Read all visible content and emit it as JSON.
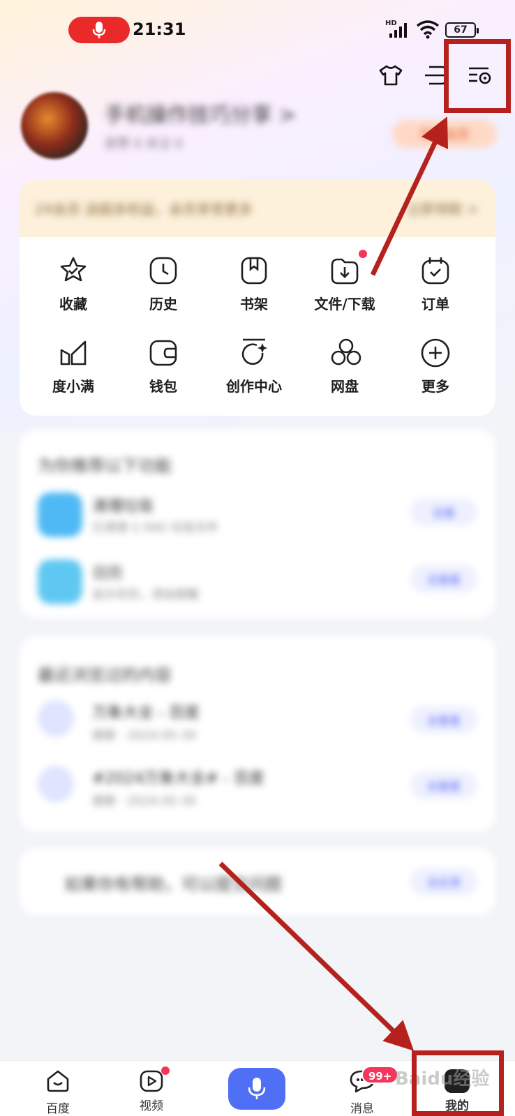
{
  "status_bar": {
    "time": "21:31",
    "battery": "67",
    "network": "HD"
  },
  "profile": {
    "name": "手机操作技巧分享 >",
    "stats": "获赞 0    关注 0",
    "vip_label": "开通会员"
  },
  "banner": {
    "text": "24会员  送超多权益，会员享受更多",
    "link": "立即领取 >"
  },
  "grid": {
    "items": [
      {
        "label": "收藏",
        "icon": "star-check-icon"
      },
      {
        "label": "历史",
        "icon": "clock-icon"
      },
      {
        "label": "书架",
        "icon": "bookmark-book-icon"
      },
      {
        "label": "文件/下载",
        "icon": "download-icon"
      },
      {
        "label": "订单",
        "icon": "calendar-check-icon"
      },
      {
        "label": "度小满",
        "icon": "duxiaoman-icon"
      },
      {
        "label": "钱包",
        "icon": "wallet-icon"
      },
      {
        "label": "创作中心",
        "icon": "creator-icon"
      },
      {
        "label": "网盘",
        "icon": "cloud-drive-icon"
      },
      {
        "label": "更多",
        "icon": "plus-circle-icon"
      }
    ]
  },
  "recommend": {
    "title": "为你推荐以下功能",
    "rows": [
      {
        "t1": "清理垃圾",
        "t2": "已清理 2.56G 垃圾文件",
        "btn": "去看"
      },
      {
        "t1": "日历",
        "t2": "显示农历，添加提醒",
        "btn": "去看看"
      }
    ]
  },
  "recent": {
    "title": "最近浏览过的内容",
    "rows": [
      {
        "t1": "万象大全 - 百度",
        "t2": "搜索 · 2024-05-30",
        "btn": "去看看"
      },
      {
        "t1": "#2024万象大全# - 百度",
        "t2": "搜索 · 2024-05-30",
        "btn": "去看看"
      }
    ]
  },
  "feedback": {
    "text": "如果你有帮助，可以提交问题",
    "btn": "去反馈"
  },
  "bottom_nav": {
    "items": [
      {
        "label": "百度",
        "icon": "baidu-home-icon"
      },
      {
        "label": "视频",
        "icon": "video-play-icon"
      },
      {
        "label": "消息",
        "icon": "message-icon"
      },
      {
        "label": "我的",
        "icon": "profile-icon"
      }
    ],
    "message_badge": "99+"
  },
  "watermark": "Baidu经验",
  "colors": {
    "accent": "#4f6ff5",
    "annotation_red": "#b5221d",
    "badge_red": "#f3365a"
  }
}
